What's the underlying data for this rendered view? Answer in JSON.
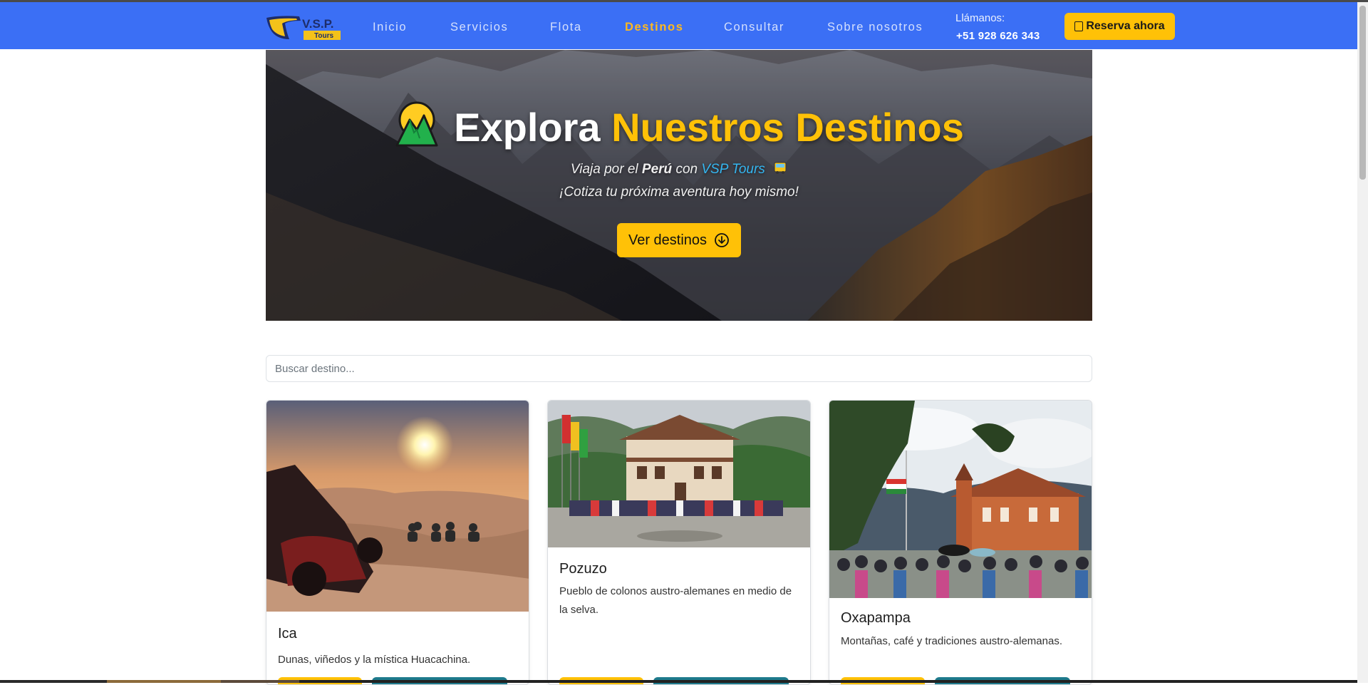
{
  "brand": {
    "logo_text": "V.S.P.",
    "logo_sub": "Tours"
  },
  "nav": {
    "items": [
      {
        "label": "Inicio",
        "active": false
      },
      {
        "label": "Servicios",
        "active": false
      },
      {
        "label": "Flota",
        "active": false
      },
      {
        "label": "Destinos",
        "active": true
      },
      {
        "label": "Consultar",
        "active": false
      },
      {
        "label": "Sobre nosotros",
        "active": false
      }
    ],
    "call_label": "Llámanos:",
    "call_number": "+51 928 626 343",
    "reserve_label": "Reserva ahora"
  },
  "hero": {
    "title_main": "Explora",
    "title_accent": "Nuestros Destinos",
    "subtitle_prefix": "Viaja por el",
    "subtitle_country": "Perú",
    "subtitle_with": "con",
    "subtitle_brand": "VSP Tours",
    "subtitle_line2": "¡Cotiza tu próxima aventura hoy mismo!",
    "button_label": "Ver destinos"
  },
  "search": {
    "placeholder": "Buscar destino..."
  },
  "destinations": [
    {
      "title": "Ica",
      "description": "Dunas, viñedos y la mística Huacachina."
    },
    {
      "title": "Pozuzo",
      "description": "Pueblo de colonos austro-alemanes en medio de la selva."
    },
    {
      "title": "Oxapampa",
      "description": "Montañas, café y tradiciones austro-alemanas."
    }
  ],
  "colors": {
    "navbar": "#3b6ff5",
    "accent": "#ffc107",
    "brand_link": "#34b6f0",
    "secondary_button": "#1e7a8c"
  }
}
